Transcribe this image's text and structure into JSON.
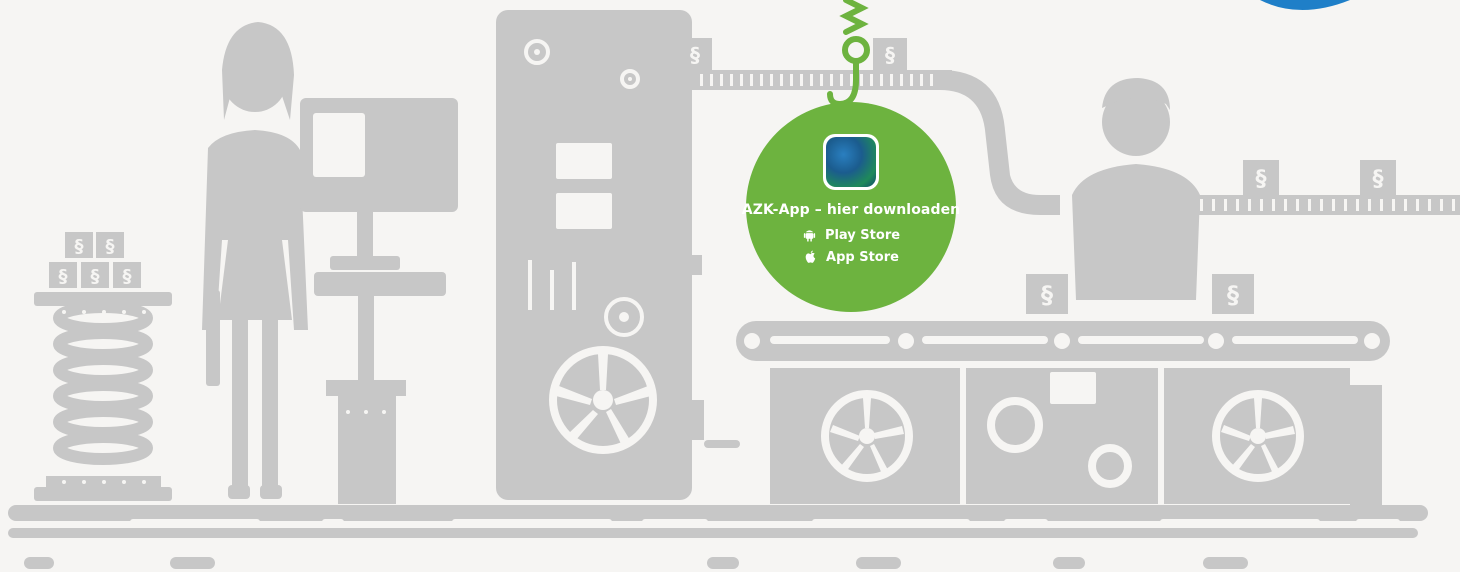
{
  "colors": {
    "background": "#f6f5f3",
    "illustration_gray": "#c7c7c7",
    "accent_green": "#6db33f",
    "text_white": "#ffffff"
  },
  "illustration": {
    "paragraph_symbol": "§"
  },
  "promo": {
    "app_icon": "azk-app-icon",
    "title": "AZK-App – hier downloaden",
    "stores": [
      {
        "icon": "android-icon",
        "label": "Play Store"
      },
      {
        "icon": "apple-icon",
        "label": "App Store"
      }
    ]
  }
}
